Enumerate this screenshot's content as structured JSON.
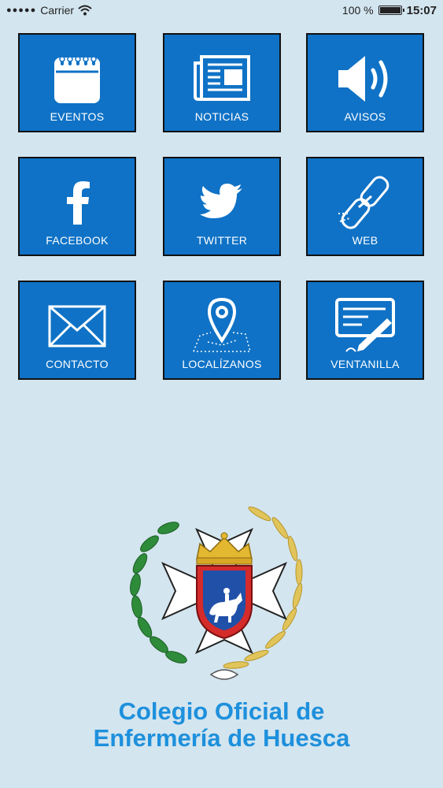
{
  "status": {
    "carrier": "Carrier",
    "battery": "100 %",
    "time": "15:07"
  },
  "tiles": [
    {
      "label": "EVENTOS",
      "icon": "calendar-icon"
    },
    {
      "label": "NOTICIAS",
      "icon": "newspaper-icon"
    },
    {
      "label": "AVISOS",
      "icon": "speaker-icon"
    },
    {
      "label": "FACEBOOK",
      "icon": "facebook-icon"
    },
    {
      "label": "TWITTER",
      "icon": "twitter-icon"
    },
    {
      "label": "WEB",
      "icon": "link-icon"
    },
    {
      "label": "CONTACTO",
      "icon": "envelope-icon"
    },
    {
      "label": "LOCALÍZANOS",
      "icon": "map-pin-icon"
    },
    {
      "label": "VENTANILLA",
      "icon": "form-sign-icon"
    }
  ],
  "organization": {
    "line1": "Colegio Oficial de",
    "line2": "Enfermería de Huesca"
  },
  "colors": {
    "tile": "#0f72c6",
    "background": "#d3e5ef",
    "brand_text": "#1e90dc"
  }
}
